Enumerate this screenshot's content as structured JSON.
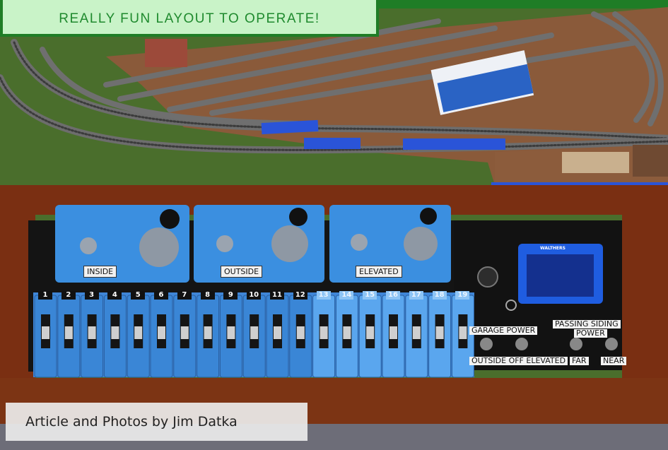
{
  "headline": {
    "text": "REALLY FUN LAYOUT TO OPERATE!"
  },
  "credit": {
    "text": "Article and Photos by Jim Datka"
  },
  "controllers": [
    {
      "label": "INSIDE"
    },
    {
      "label": "OUTSIDE"
    },
    {
      "label": "ELEVATED"
    }
  ],
  "switch_numbers": [
    "1",
    "2",
    "3",
    "4",
    "5",
    "6",
    "7",
    "8",
    "9",
    "10",
    "11",
    "12",
    "13",
    "14",
    "15",
    "16",
    "17",
    "18",
    "19"
  ],
  "panel": {
    "brand": "WALTHERS",
    "garage_power": "GARAGE POWER",
    "passing_siding_line1": "PASSING SIDING",
    "passing_siding_line2": "POWER",
    "outside_off_elevated": "OUTSIDE OFF ELEVATED",
    "far": "FAR",
    "near": "NEAR"
  },
  "colors": {
    "headline_bg": "#c9f3c8",
    "headline_border": "#1f7d26",
    "headline_text": "#1f8a2e",
    "controller_blue": "#3b8fe0",
    "wood": "#8a3f1c",
    "panel_black": "#121212",
    "grass": "#4a6e2c",
    "dirt": "#8a5a3a"
  }
}
